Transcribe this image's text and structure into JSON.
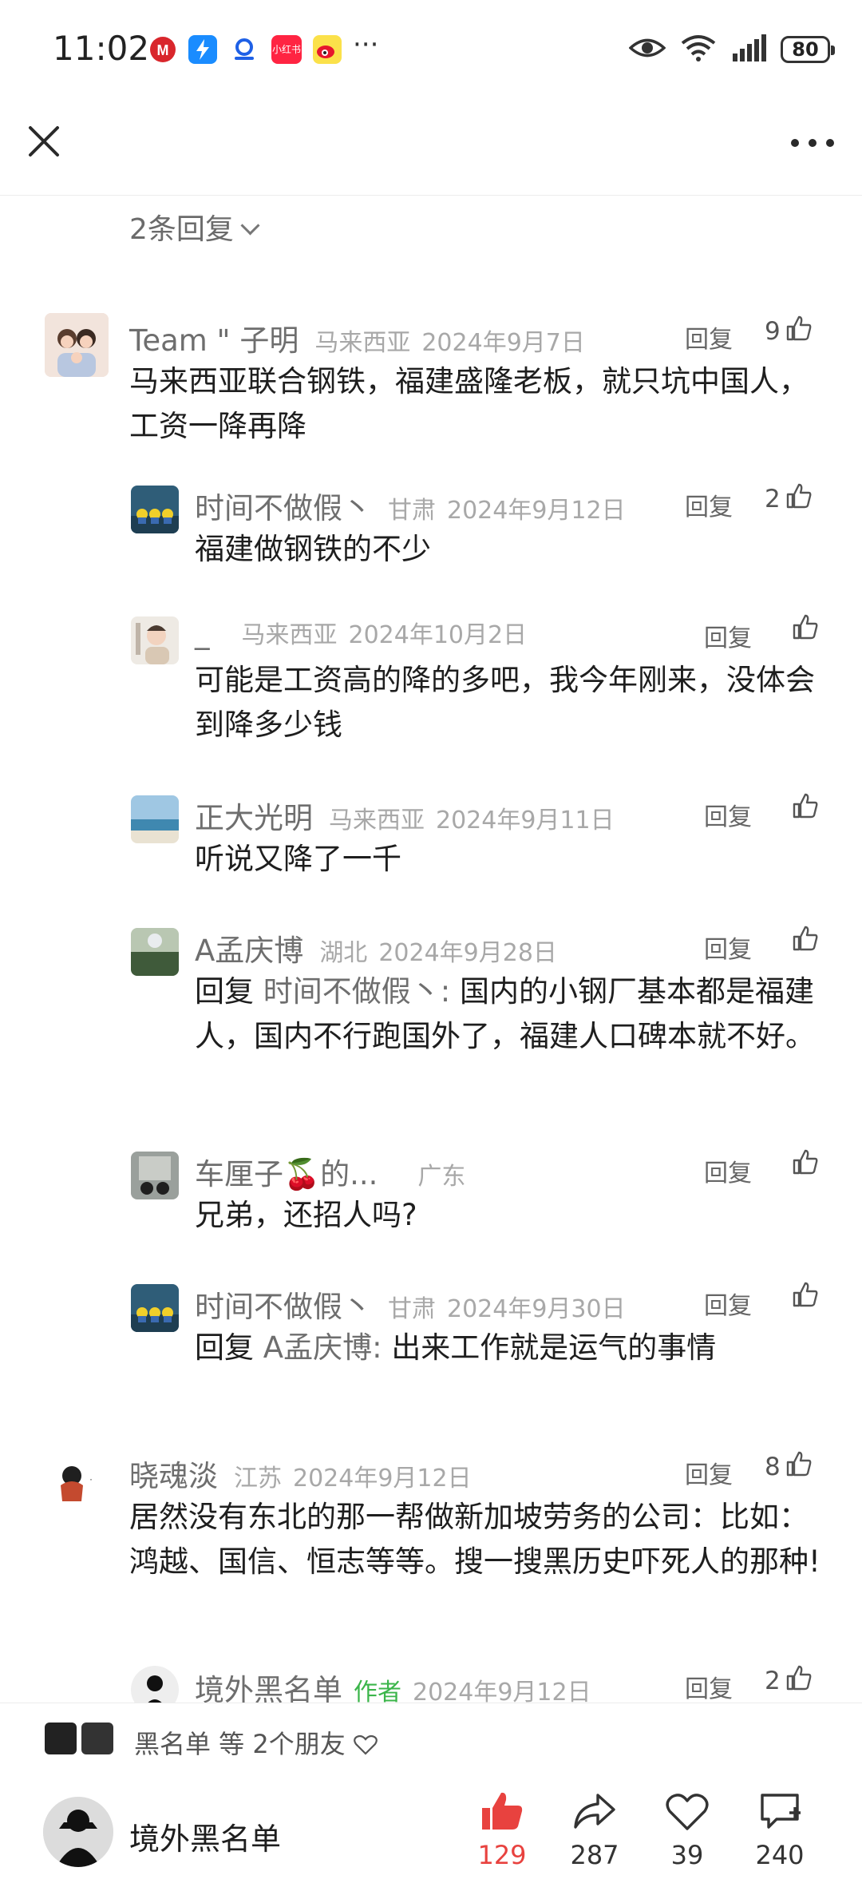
{
  "status_bar": {
    "time": "11:02",
    "more": "···",
    "battery": "80",
    "app_icons": [
      "metro-icon",
      "lightning-app-icon",
      "map-app-icon",
      "xiaohongshu-icon",
      "weibo-icon"
    ],
    "xiaohongshu_label": "小红书"
  },
  "thread": {
    "collapse_label": "2条回复"
  },
  "comments": [
    {
      "user": "Team \"     子明",
      "location": "马来西亚",
      "date": "2024年9月7日",
      "reply": "回复",
      "likes": "9",
      "text": "马来西亚联合钢铁，福建盛隆老板，就只坑中国人，工资一降再降"
    },
    {
      "user": "时间不做假丶",
      "location": "甘肃",
      "date": "2024年9月12日",
      "reply": "回复",
      "likes": "2",
      "text": "福建做钢铁的不少"
    },
    {
      "user": "_",
      "location": "马来西亚",
      "date": "2024年10月2日",
      "reply": "回复",
      "likes": "",
      "text": "可能是工资高的降的多吧，我今年刚来，没体会到降多少钱"
    },
    {
      "user": "正大光明",
      "location": "马来西亚",
      "date": "2024年9月11日",
      "reply": "回复",
      "likes": "",
      "text": "听说又降了一千"
    },
    {
      "user": "A孟庆博",
      "location": "湖北",
      "date": "2024年9月28日",
      "reply": "回复",
      "likes": "",
      "reply_prefix": "回复",
      "reply_to": "时间不做假丶:",
      "text": "国内的小钢厂基本都是福建人，国内不行跑国外了，福建人口碑本就不好。"
    },
    {
      "user": "车厘子🍒的...",
      "location": "广东",
      "date": "",
      "reply": "回复",
      "likes": "",
      "text": "兄弟，还招人吗?"
    },
    {
      "user": "时间不做假丶",
      "location": "甘肃",
      "date": "2024年9月30日",
      "reply": "回复",
      "likes": "",
      "reply_prefix": "回复",
      "reply_to": "A孟庆博:",
      "text": "出来工作就是运气的事情"
    },
    {
      "user": "晓魂淡",
      "location": "江苏",
      "date": "2024年9月12日",
      "reply": "回复",
      "likes": "8",
      "text": "居然没有东北的那一帮做新加坡劳务的公司：比如：鸿越、国信、恒志等等。搜一搜黑历史吓死人的那种!"
    },
    {
      "user": "境外黑名单",
      "author_tag": "作者",
      "location": "",
      "date": "2024年9月12日",
      "reply": "回复",
      "likes": "2",
      "text": ""
    }
  ],
  "friends_bar": {
    "text": "黑名单 等 2个朋友"
  },
  "bottom_bar": {
    "author_name": "境外黑名单",
    "likes": "129",
    "shares": "287",
    "favorites": "39",
    "comments": "240"
  },
  "colors": {
    "accent_like": "#e8423f",
    "author_tag": "#3bb54a"
  }
}
